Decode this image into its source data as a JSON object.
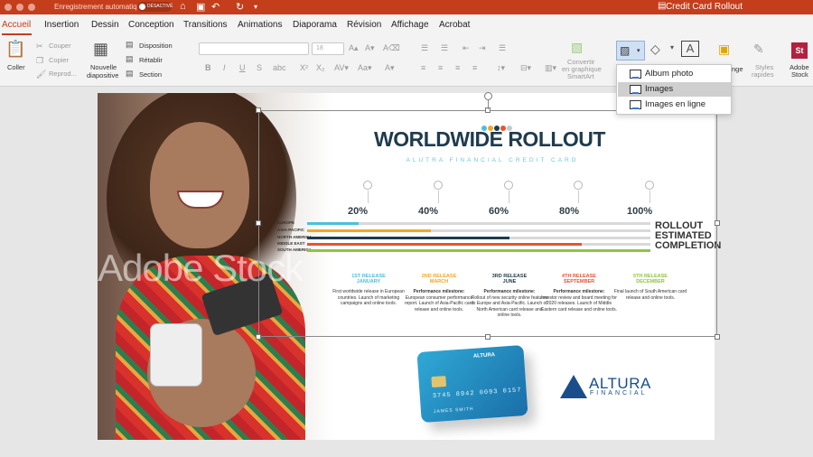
{
  "titlebar": {
    "autosave_label": "Enregistrement automatique",
    "toggle_state": "DÉSACTIVÉ",
    "document_title": "Credit Card Rollout"
  },
  "menu": [
    "Accueil",
    "Insertion",
    "Dessin",
    "Conception",
    "Transitions",
    "Animations",
    "Diaporama",
    "Révision",
    "Affichage",
    "Acrobat"
  ],
  "ribbon": {
    "paste": "Coller",
    "cut": "Couper",
    "copy": "Copier",
    "format_painter": "Reprod...",
    "new_slide_line1": "Nouvelle",
    "new_slide_line2": "diapositive",
    "layout": "Disposition",
    "reset": "Rétablir",
    "section": "Section",
    "font_size": "18",
    "convert_line1": "Convertir",
    "convert_line2": "en graphique",
    "convert_line3": "SmartArt",
    "arrange": "nge",
    "styles_line1": "Styles",
    "styles_line2": "rapides",
    "stock_line1": "Adobe",
    "stock_line2": "Stock",
    "stock_icon_text": "St"
  },
  "image_menu": {
    "items": [
      "Album photo",
      "Images",
      "Images en ligne"
    ],
    "highlighted_index": 1
  },
  "slide": {
    "watermark": "Adobe Stock",
    "title": "WORLDWIDE ROLLOUT",
    "subtitle": "ALUTRA FINANCIAL CREDIT CARD",
    "percentages": [
      "20%",
      "40%",
      "60%",
      "80%",
      "100%"
    ],
    "regions": [
      {
        "name": "EUROPE",
        "color": "#4bc0d9",
        "progress": 0.15
      },
      {
        "name": "ASIA-PACIFIC",
        "color": "#f5a623",
        "progress": 0.36
      },
      {
        "name": "NORTH AMERICA",
        "color": "#1f3b4d",
        "progress": 0.59
      },
      {
        "name": "MIDDLE EAST",
        "color": "#e8532f",
        "progress": 0.8
      },
      {
        "name": "SOUTH AMERICA",
        "color": "#8cc63f",
        "progress": 1.0
      }
    ],
    "rollout_label": [
      "ROLLOUT",
      "ESTIMATED",
      "COMPLETION"
    ],
    "releases": [
      {
        "title": "1ST RELEASE",
        "month": "JANUARY",
        "color": "#4bc0d9",
        "milestone": "",
        "text": "First worldwide release in European countries. Launch of marketing campaigns and online tools."
      },
      {
        "title": "2ND RELEASE",
        "month": "MARCH",
        "color": "#f5a623",
        "milestone": "Performance milestone:",
        "text": "European consumer performance report. Launch of Asia-Pacific card release and online tools."
      },
      {
        "title": "3RD RELEASE",
        "month": "JUNE",
        "color": "#1f3b4d",
        "milestone": "Performance milestone:",
        "text": "Rollout of new security online features to Europe and Asia-Pacific. Launch of North American card release and online tools."
      },
      {
        "title": "4TH RELEASE",
        "month": "SEPTEMBER",
        "color": "#e8532f",
        "milestone": "Performance milestone:",
        "text": "Investor review and board meeting for 2020 releases. Launch of Middle Eastern card release and online tools."
      },
      {
        "title": "5TH RELEASE",
        "month": "DECEMBER",
        "color": "#8cc63f",
        "milestone": "",
        "text": "Final launch of South American card release and online tools."
      }
    ],
    "card": {
      "brand": "ALTURA",
      "number": "3745 8942 0093 0157",
      "name": "JAMES SMITH"
    },
    "logo": {
      "word": "ALTURA",
      "sub": "FINANCIAL"
    },
    "dot_colors": [
      "#4bc0d9",
      "#f5a623",
      "#1f3b4d",
      "#e8532f",
      "#c8c8c8"
    ]
  }
}
